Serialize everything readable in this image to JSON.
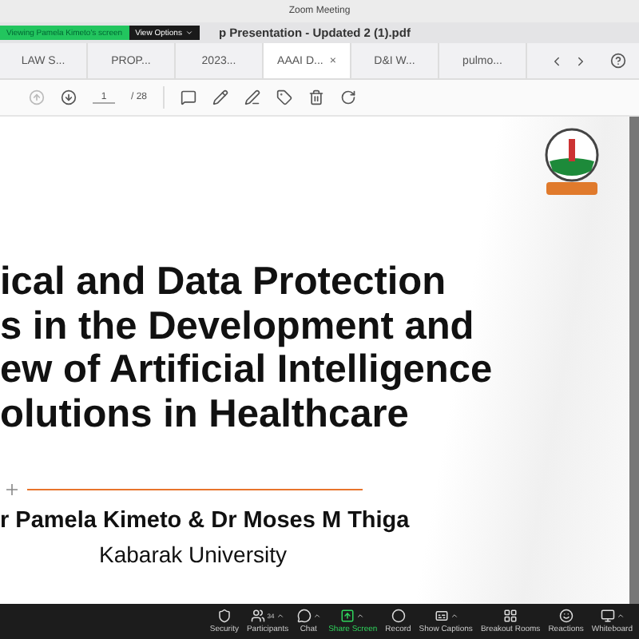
{
  "window": {
    "title": "Zoom Meeting"
  },
  "banner": {
    "text": "Viewing Pamela Kimeto's screen",
    "options": "View Options"
  },
  "document_title": "p Presentation - Updated 2 (1).pdf",
  "tabs": [
    {
      "label": "LAW S...",
      "selected": false
    },
    {
      "label": "PROP...",
      "selected": false
    },
    {
      "label": "2023...",
      "selected": false
    },
    {
      "label": "AAAI D...",
      "selected": true,
      "close": "×"
    },
    {
      "label": "D&I W...",
      "selected": false
    },
    {
      "label": "pulmo...",
      "selected": false
    }
  ],
  "pdf_toolbar": {
    "page": "1",
    "total": "/ 28"
  },
  "slide": {
    "title_lines": [
      "ical and Data Protection",
      "s in the Development and",
      "ew of Artificial Intelligence",
      "olutions in Healthcare"
    ],
    "authors": "r Pamela Kimeto & Dr Moses M Thiga",
    "institution": "Kabarak University"
  },
  "meeting_controls": [
    {
      "kind": "security",
      "label": "Security"
    },
    {
      "kind": "participants",
      "label": "Participants",
      "count": "34",
      "caret": true
    },
    {
      "kind": "chat",
      "label": "Chat",
      "caret": true
    },
    {
      "kind": "share",
      "label": "Share Screen",
      "caret": true
    },
    {
      "kind": "record",
      "label": "Record"
    },
    {
      "kind": "captions",
      "label": "Show Captions",
      "caret": true
    },
    {
      "kind": "breakout",
      "label": "Breakout Rooms"
    },
    {
      "kind": "reactions",
      "label": "Reactions"
    },
    {
      "kind": "whiteboard",
      "label": "Whiteboard",
      "caret": true
    }
  ]
}
